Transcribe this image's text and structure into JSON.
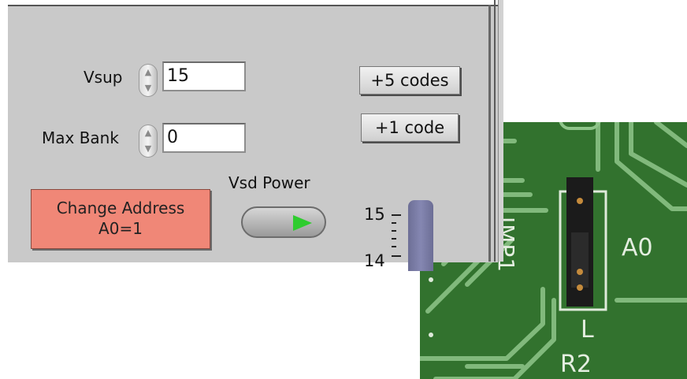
{
  "panel": {
    "vsup": {
      "label": "Vsup",
      "value": "15"
    },
    "max_bank": {
      "label": "Max Bank",
      "value": "0"
    },
    "plus5_button": "+5 codes",
    "plus1_button": "+1 code",
    "change_address": {
      "line1": "Change Address",
      "line2": "A0=1"
    },
    "vsd_power_label": "Vsd Power",
    "vsd_power_on": true,
    "scale": {
      "tick_top": "15",
      "tick_bottom": "14"
    },
    "colors": {
      "panel_bg": "#c9c9c9",
      "change_address_bg": "#f08777",
      "led_on": "#2ecc2e",
      "slider": "#7a7ca6"
    }
  },
  "board_photo": {
    "silkscreen": {
      "jumper": "JMP1",
      "address": "A0",
      "l": "L",
      "resistor": "R2"
    },
    "colors": {
      "pcb": "#2e6a2a",
      "trace": "#8fc68a"
    }
  }
}
